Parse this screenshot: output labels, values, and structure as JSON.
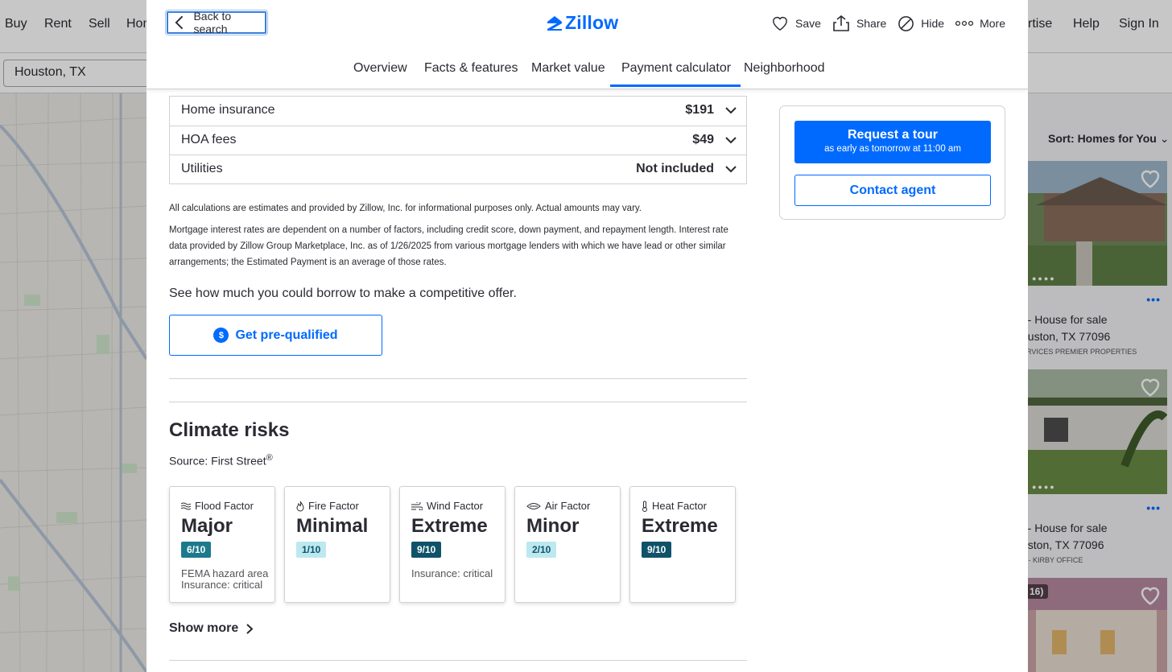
{
  "background": {
    "nav": [
      "Buy",
      "Rent",
      "Sell",
      "Hom",
      "rtise",
      "Help",
      "Sign In"
    ],
    "search_value": "Houston, TX",
    "sort": {
      "label": "Sort:",
      "value": "Homes for You"
    },
    "listings": [
      {
        "line1": "ft - House for sale",
        "line2": "ouston, TX 77096",
        "line3": "ERVICES PREMIER PROPERTIES"
      },
      {
        "line1": "ft - House for sale",
        "line2": "uston, TX 77096",
        "line3": "S - KIRBY OFFICE"
      },
      {
        "badge": "16)"
      }
    ]
  },
  "modal": {
    "back_label": "Back to search",
    "logo_text": "Zillow",
    "actions": {
      "save": "Save",
      "share": "Share",
      "hide": "Hide",
      "more": "More"
    },
    "tabs": [
      "Overview",
      "Facts & features",
      "Market value",
      "Payment calculator",
      "Neighborhood"
    ],
    "active_tab": "Payment calculator",
    "costs": [
      {
        "label": "Home insurance",
        "value": "$191"
      },
      {
        "label": "HOA fees",
        "value": "$49"
      },
      {
        "label": "Utilities",
        "value": "Not included"
      }
    ],
    "disclaimer1": "All calculations are estimates and provided by Zillow, Inc. for informational purposes only. Actual amounts may vary.",
    "disclaimer2": "Mortgage interest rates are dependent on a number of factors, including credit score, down payment, and repayment length. Interest rate data provided by Zillow Group Marketplace, Inc. as of 1/26/2025 from various mortgage lenders with which we have lead or other similar arrangements; the Estimated Payment is an average of those rates.",
    "borrow_text": "See how much you could borrow to make a competitive offer.",
    "prequal_label": "Get pre-qualified",
    "prequal_icon": "$",
    "climate": {
      "title": "Climate risks",
      "source": "Source: First Street",
      "source_mark": "®",
      "factors": [
        {
          "name": "Flood Factor",
          "icon": "flood-icon",
          "level": "Major",
          "score": "6/10",
          "note": "FEMA hazard area Insurance: critical",
          "color": "#1d7a8c"
        },
        {
          "name": "Fire Factor",
          "icon": "fire-icon",
          "level": "Minimal",
          "score": "1/10",
          "note": "",
          "color": "#bde8ef"
        },
        {
          "name": "Wind Factor",
          "icon": "wind-icon",
          "level": "Extreme",
          "score": "9/10",
          "note": "Insurance: critical",
          "color": "#0f5269"
        },
        {
          "name": "Air Factor",
          "icon": "air-icon",
          "level": "Minor",
          "score": "2/10",
          "note": "",
          "color": "#bde8ef"
        },
        {
          "name": "Heat Factor",
          "icon": "heat-icon",
          "level": "Extreme",
          "score": "9/10",
          "note": "",
          "color": "#0f5269"
        }
      ],
      "show_more": "Show more"
    },
    "sidebar": {
      "tour_label": "Request a tour",
      "tour_sub": "as early as tomorrow at 11:00 am",
      "contact_label": "Contact agent"
    }
  }
}
